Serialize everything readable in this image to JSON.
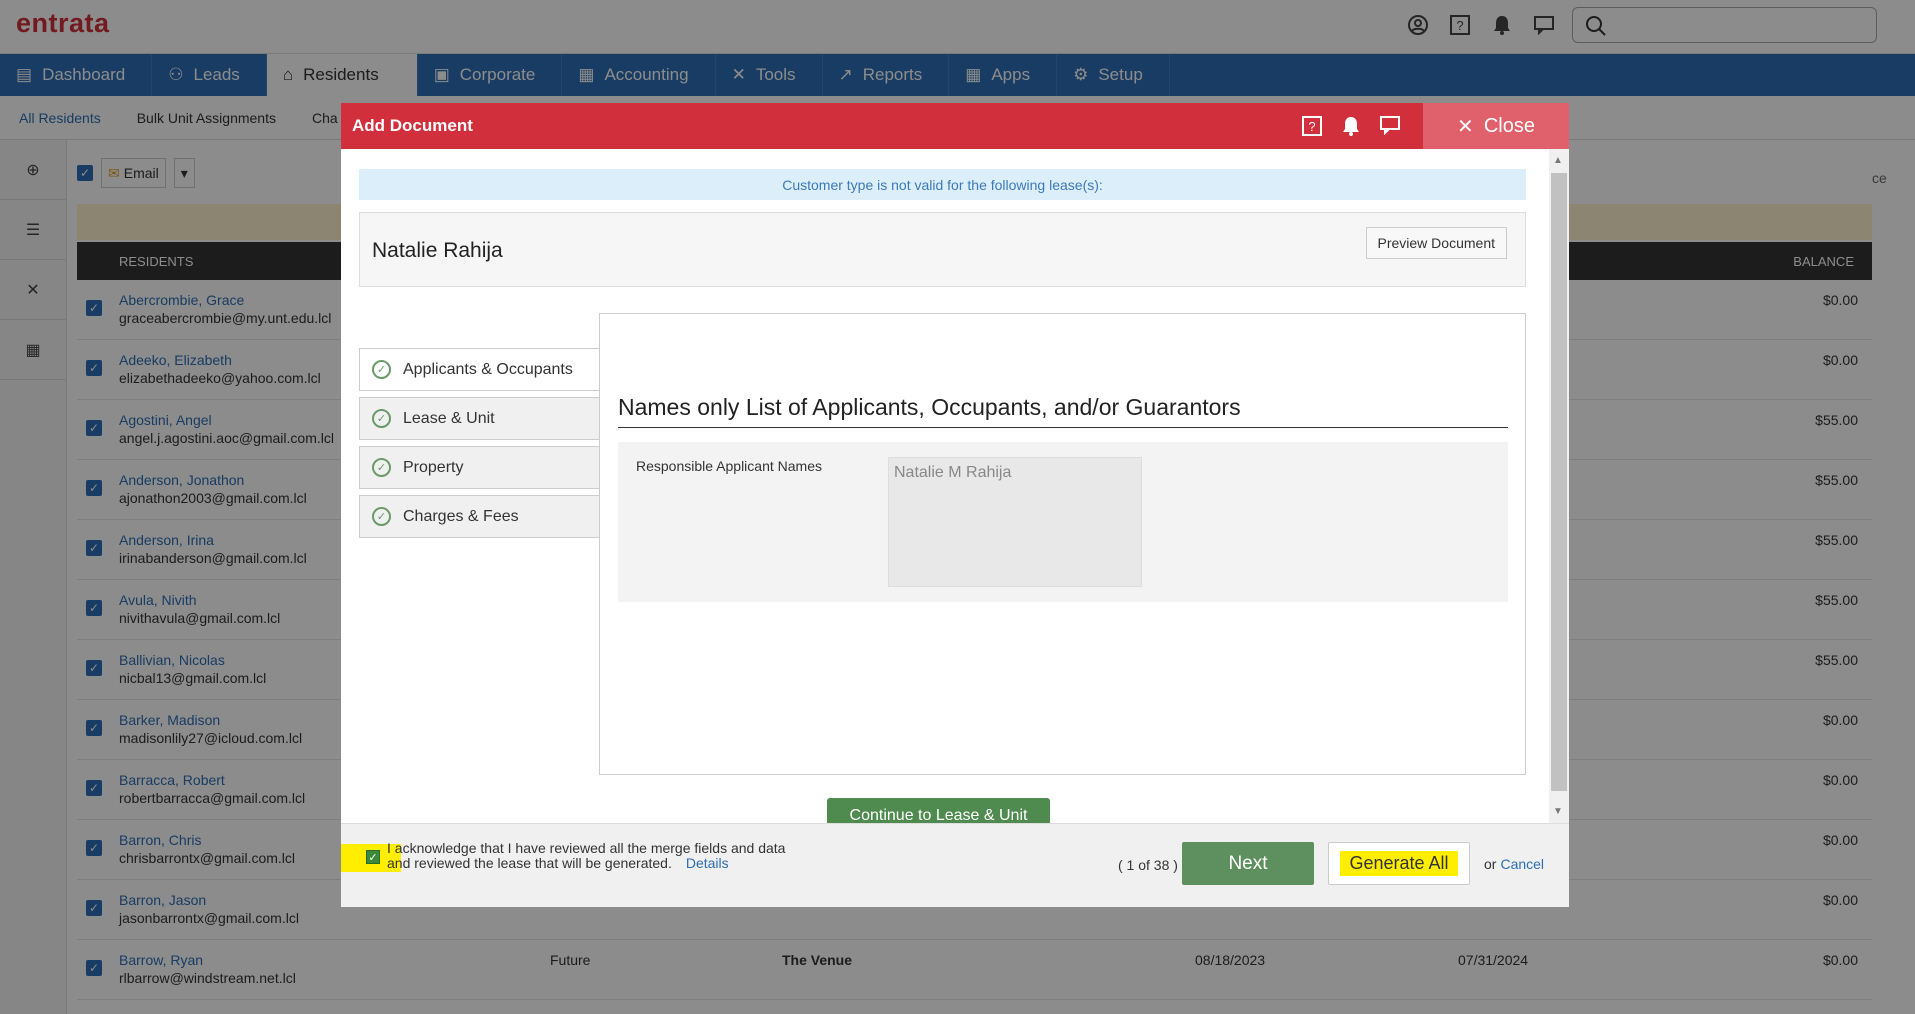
{
  "app": {
    "logo": "entrata"
  },
  "search": {
    "placeholder": ""
  },
  "nav": {
    "items": [
      {
        "label": "Dashboard",
        "icon": "clipboard-icon"
      },
      {
        "label": "Leads",
        "icon": "people-icon"
      },
      {
        "label": "Residents",
        "icon": "home-icon"
      },
      {
        "label": "Corporate",
        "icon": "building-icon"
      },
      {
        "label": "Accounting",
        "icon": "calculator-icon"
      },
      {
        "label": "Tools",
        "icon": "wrench-icon"
      },
      {
        "label": "Reports",
        "icon": "chart-icon"
      },
      {
        "label": "Apps",
        "icon": "grid-icon"
      },
      {
        "label": "Setup",
        "icon": "gear-icon"
      }
    ],
    "active": "Residents"
  },
  "subnav": {
    "items": [
      "All Residents",
      "Bulk Unit Assignments",
      "Cha"
    ]
  },
  "list": {
    "email_label": "Email",
    "right_label": "ce",
    "header": {
      "residents": "RESIDENTS",
      "balance": "BALANCE"
    },
    "rows": [
      {
        "name": "Abercrombie, Grace",
        "email": "graceabercrombie@my.unt.edu.lcl",
        "balance": "$0.00",
        "status": "",
        "property": "",
        "move_in": "",
        "move_out": ""
      },
      {
        "name": "Adeeko, Elizabeth",
        "email": "elizabethadeeko@yahoo.com.lcl",
        "balance": "$0.00",
        "status": "",
        "property": "",
        "move_in": "",
        "move_out": ""
      },
      {
        "name": "Agostini, Angel",
        "email": "angel.j.agostini.aoc@gmail.com.lcl",
        "balance": "$55.00",
        "status": "",
        "property": "",
        "move_in": "",
        "move_out": ""
      },
      {
        "name": "Anderson, Jonathon",
        "email": "ajonathon2003@gmail.com.lcl",
        "balance": "$55.00",
        "status": "",
        "property": "",
        "move_in": "",
        "move_out": ""
      },
      {
        "name": "Anderson, Irina",
        "email": "irinabanderson@gmail.com.lcl",
        "balance": "$55.00",
        "status": "",
        "property": "",
        "move_in": "",
        "move_out": ""
      },
      {
        "name": "Avula, Nivith",
        "email": "nivithavula@gmail.com.lcl",
        "balance": "$55.00",
        "status": "",
        "property": "",
        "move_in": "",
        "move_out": ""
      },
      {
        "name": "Ballivian, Nicolas",
        "email": "nicbal13@gmail.com.lcl",
        "balance": "$55.00",
        "status": "",
        "property": "",
        "move_in": "",
        "move_out": ""
      },
      {
        "name": "Barker, Madison",
        "email": "madisonlily27@icloud.com.lcl",
        "balance": "$0.00",
        "status": "",
        "property": "",
        "move_in": "",
        "move_out": ""
      },
      {
        "name": "Barracca, Robert",
        "email": "robertbarracca@gmail.com.lcl",
        "balance": "$0.00",
        "status": "",
        "property": "",
        "move_in": "",
        "move_out": ""
      },
      {
        "name": "Barron, Chris",
        "email": "chrisbarrontx@gmail.com.lcl",
        "balance": "$0.00",
        "status": "",
        "property": "",
        "move_in": "",
        "move_out": ""
      },
      {
        "name": "Barron, Jason",
        "email": "jasonbarrontx@gmail.com.lcl",
        "balance": "$0.00",
        "status": "",
        "property": "",
        "move_in": "",
        "move_out": ""
      },
      {
        "name": "Barrow, Ryan",
        "email": "rlbarrow@windstream.net.lcl",
        "balance": "$0.00",
        "status": "Future",
        "property": "The Venue",
        "move_in": "08/18/2023",
        "move_out": "07/31/2024"
      }
    ]
  },
  "modal": {
    "title": "Add Document",
    "close_label": "Close",
    "notice": "Customer type is not valid for the following lease(s):",
    "resident_name": "Natalie Rahija",
    "preview_label": "Preview Document",
    "steps": [
      {
        "label": "Applicants & Occupants"
      },
      {
        "label": "Lease & Unit"
      },
      {
        "label": "Property"
      },
      {
        "label": "Charges & Fees"
      }
    ],
    "section_title": "Names only List of Applicants, Occupants, and/or Guarantors",
    "field_label": "Responsible Applicant Names",
    "field_value": "Natalie M Rahija",
    "continue_label": "Continue to Lease & Unit",
    "ack_line1": "I acknowledge that I have reviewed all the merge fields and data",
    "ack_line2": "and reviewed the lease that will be generated.",
    "details_label": "Details",
    "pager": "( 1 of 38 )",
    "next_label": "Next",
    "generate_label": "Generate All",
    "or_label": "or",
    "cancel_label": "Cancel"
  }
}
